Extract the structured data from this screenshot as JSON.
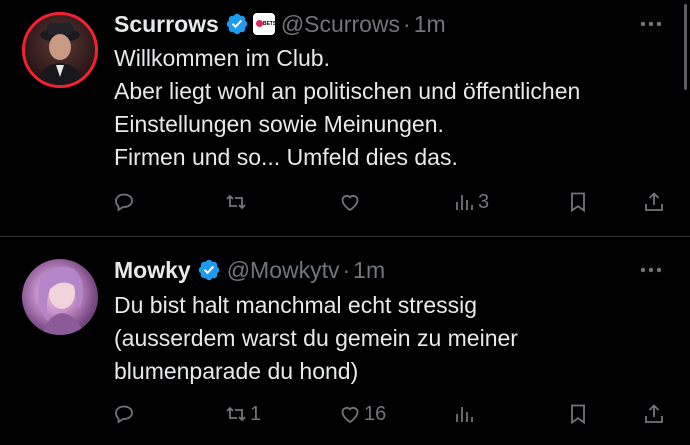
{
  "tweets": [
    {
      "name": "Scurrows",
      "handle": "@Scurrows",
      "separator": "·",
      "time": "1m",
      "affiliation_badge_text": "BETS",
      "lines": [
        "Willkommen im Club.",
        "Aber liegt wohl an politischen und öffentlichen",
        "Einstellungen sowie Meinungen.",
        "Firmen und so... Umfeld dies das."
      ],
      "actions": {
        "reply": "",
        "repost": "",
        "like": "",
        "views": "3"
      }
    },
    {
      "name": "Mowky",
      "handle": "@Mowkytv",
      "separator": "·",
      "time": "1m",
      "lines": [
        "Du bist halt manchmal echt stressig",
        "(ausserdem warst du gemein zu meiner",
        "blumenparade du hond)"
      ],
      "actions": {
        "reply": "",
        "repost": "1",
        "like": "16",
        "views": ""
      }
    }
  ],
  "icons": {
    "verified": "verified-badge-icon",
    "more": "more-icon",
    "reply": "reply-icon",
    "repost": "repost-icon",
    "like": "like-icon",
    "views": "views-icon",
    "bookmark": "bookmark-icon",
    "share": "share-icon"
  },
  "colors": {
    "background": "#000000",
    "text": "#e7e9ea",
    "secondary": "#71767b",
    "verified": "#1d9bf0",
    "avatar_ring": "#f4212e",
    "divider": "#2f3336"
  }
}
